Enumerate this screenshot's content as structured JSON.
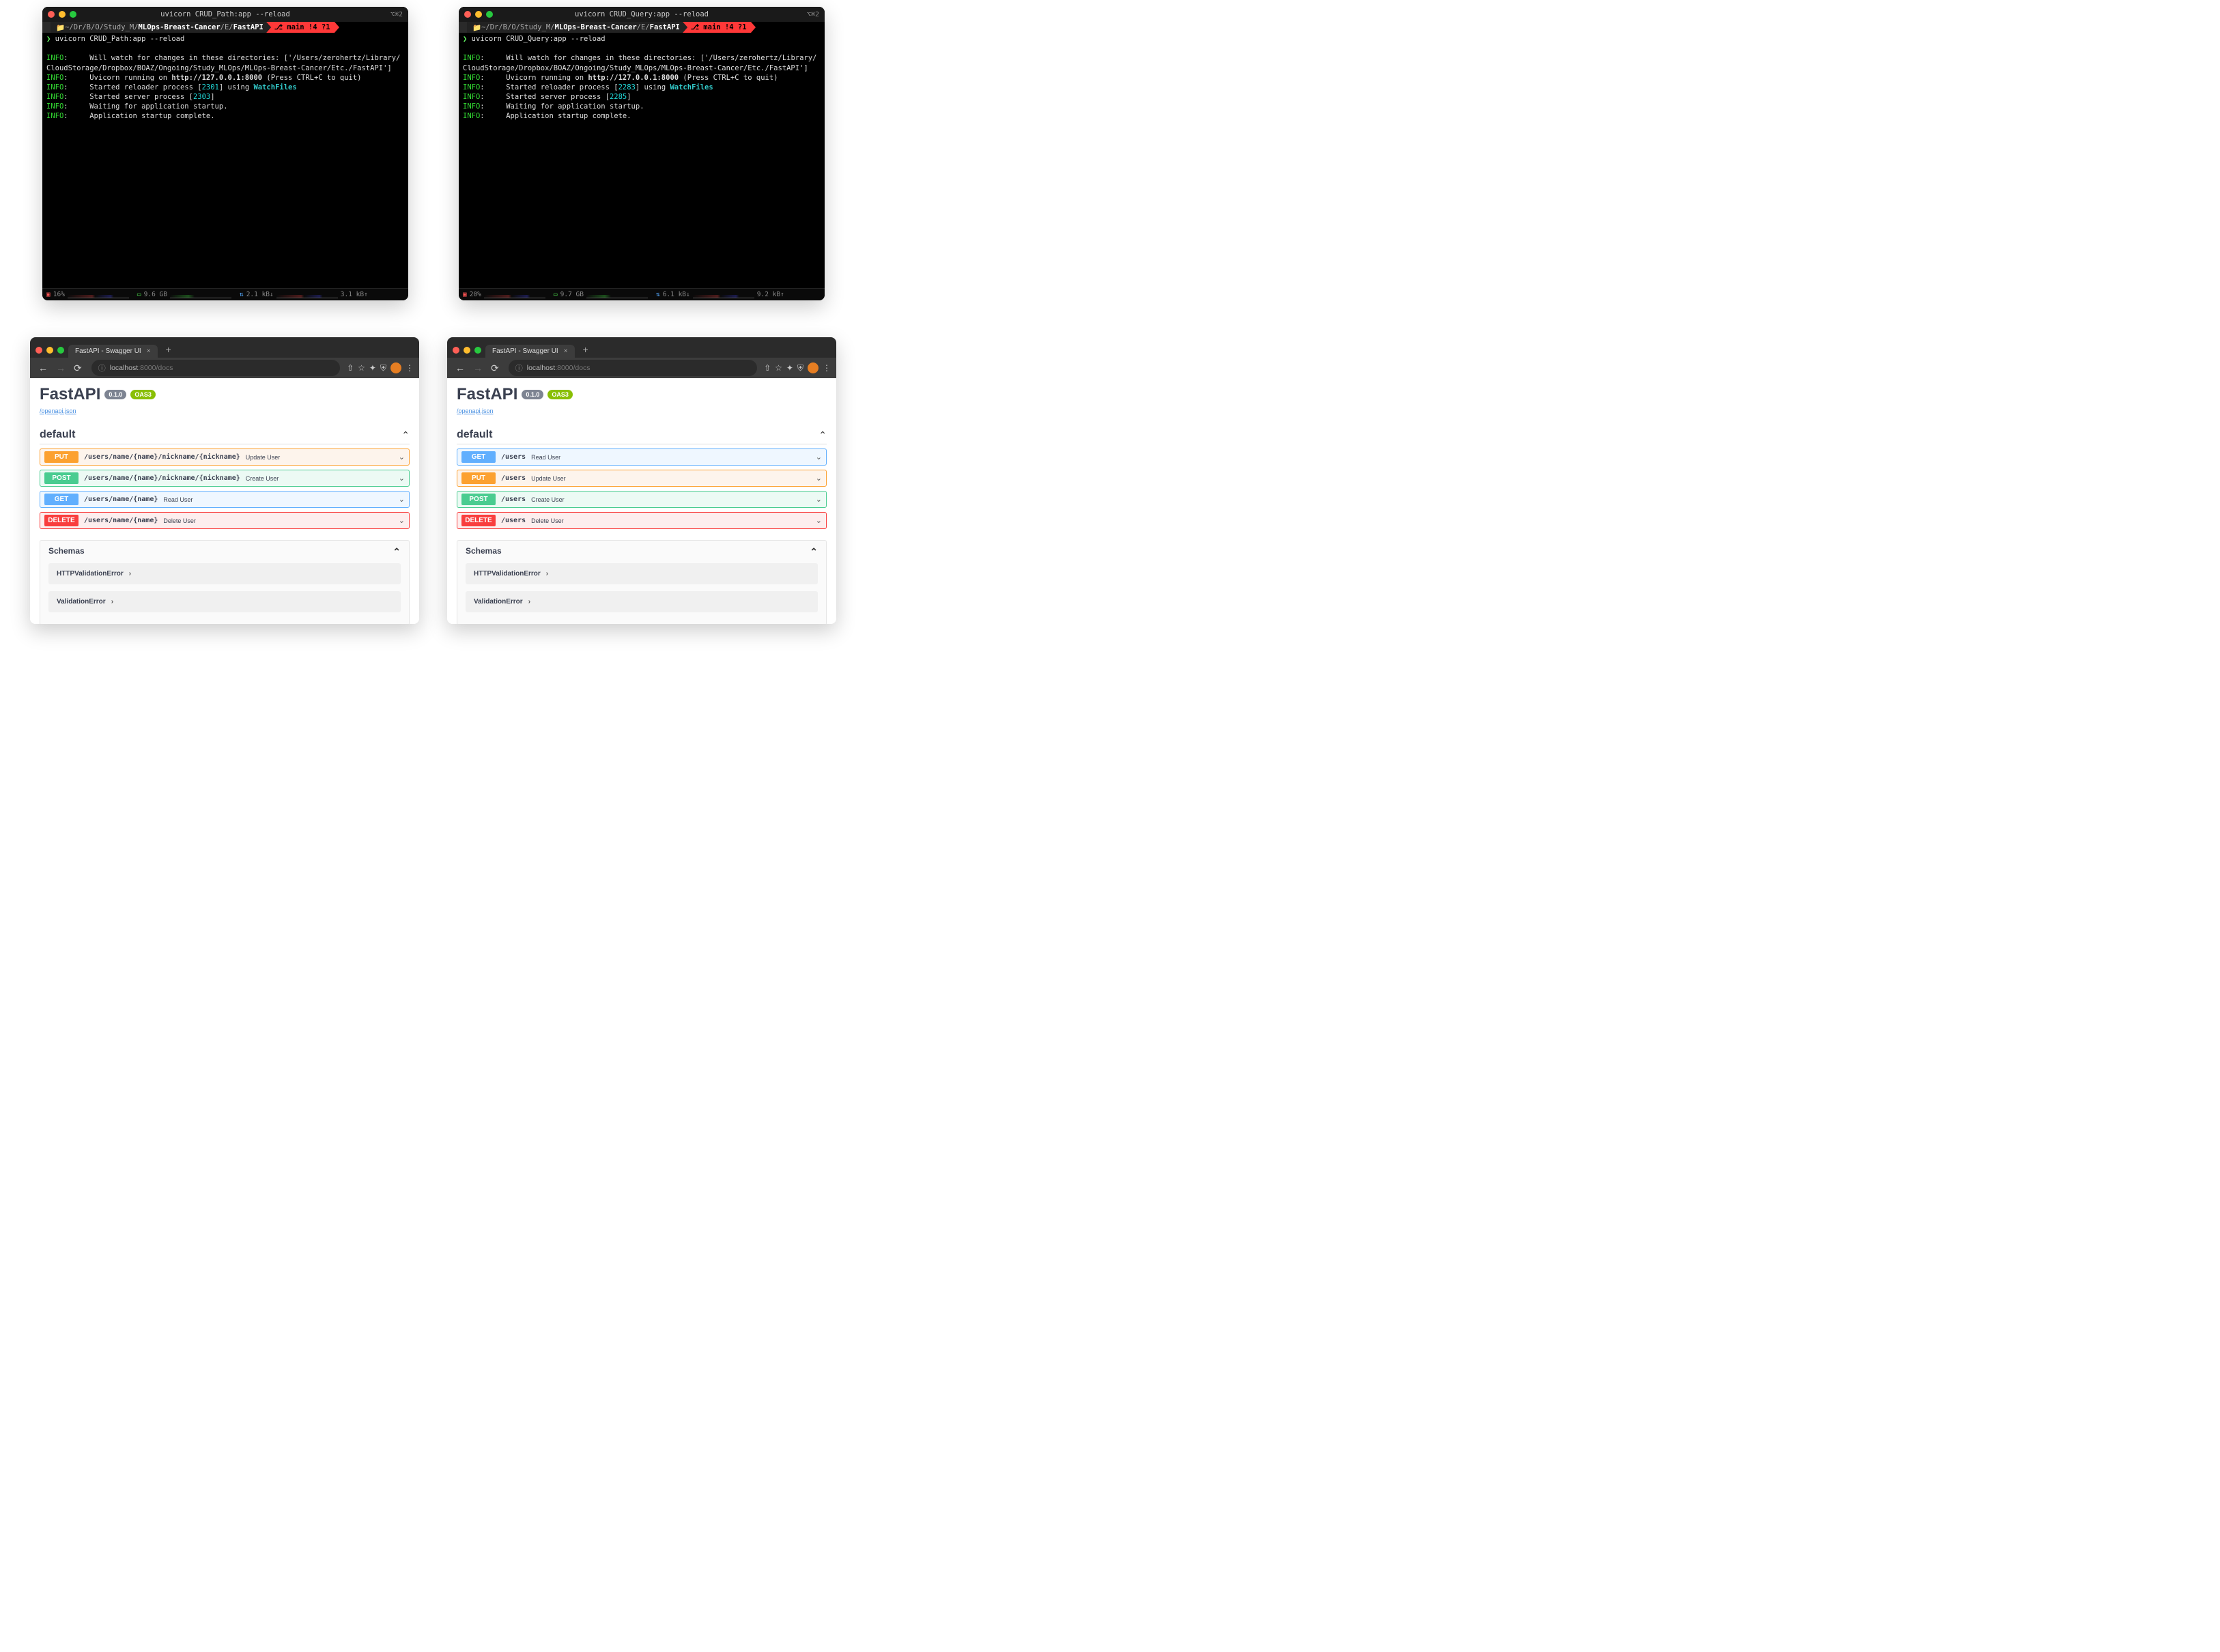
{
  "terminals": [
    {
      "title": "uvicorn CRUD_Path:app --reload",
      "right_indicator": "⌥⌘2",
      "path": {
        "prefix": "~/Dr/B/O/Study_M/",
        "bold1": "MLOps-Breast-Cancer",
        "mid": "/E/",
        "bold2": "FastAPI"
      },
      "git": "⎇ main !4 ?1",
      "command": "uvicorn CRUD_Path:app --reload",
      "lines": [
        "Will watch for changes in these directories: ['/Users/zerohertz/Library/CloudStorage/Dropbox/BOAZ/Ongoing/Study_MLOps/MLOps-Breast-Cancer/Etc./FastAPI']",
        "Uvicorn running on http://127.0.0.1:8000 (Press CTRL+C to quit)",
        "Started reloader process [2301] using WatchFiles",
        "Started server process [2303]",
        "Waiting for application startup.",
        "Application startup complete."
      ],
      "pid1": "2301",
      "pid2": "2303",
      "status": {
        "cpu": "16%",
        "mem": "9.6 GB",
        "net_down": "2.1 kB↓",
        "net_up": "3.1 kB↑"
      }
    },
    {
      "title": "uvicorn CRUD_Query:app --reload",
      "right_indicator": "⌥⌘2",
      "path": {
        "prefix": "~/Dr/B/O/Study_M/",
        "bold1": "MLOps-Breast-Cancer",
        "mid": "/E/",
        "bold2": "FastAPI"
      },
      "git": "⎇ main !4 ?1",
      "command": "uvicorn CRUD_Query:app --reload",
      "lines": [
        "Will watch for changes in these directories: ['/Users/zerohertz/Library/CloudStorage/Dropbox/BOAZ/Ongoing/Study_MLOps/MLOps-Breast-Cancer/Etc./FastAPI']",
        "Uvicorn running on http://127.0.0.1:8000 (Press CTRL+C to quit)",
        "Started reloader process [2283] using WatchFiles",
        "Started server process [2285]",
        "Waiting for application startup.",
        "Application startup complete."
      ],
      "pid1": "2283",
      "pid2": "2285",
      "status": {
        "cpu": "20%",
        "mem": "9.7 GB",
        "net_down": "6.1 kB↓",
        "net_up": "9.2 kB↑"
      }
    }
  ],
  "browsers": [
    {
      "tab_title": "FastAPI - Swagger UI",
      "url_host": "localhost",
      "url_path": ":8000/docs",
      "swagger": {
        "title": "FastAPI",
        "version": "0.1.0",
        "oas": "OAS3",
        "openapi_link": "/openapi.json",
        "section": "default",
        "ops": [
          {
            "method": "PUT",
            "cls": "put",
            "path": "/users/name/{name}/nickname/{nickname}",
            "summary": "Update User"
          },
          {
            "method": "POST",
            "cls": "post",
            "path": "/users/name/{name}/nickname/{nickname}",
            "summary": "Create User"
          },
          {
            "method": "GET",
            "cls": "get",
            "path": "/users/name/{name}",
            "summary": "Read User"
          },
          {
            "method": "DELETE",
            "cls": "delete",
            "path": "/users/name/{name}",
            "summary": "Delete User"
          }
        ],
        "schemas_label": "Schemas",
        "schemas": [
          "HTTPValidationError",
          "ValidationError"
        ]
      }
    },
    {
      "tab_title": "FastAPI - Swagger UI",
      "url_host": "localhost",
      "url_path": ":8000/docs",
      "swagger": {
        "title": "FastAPI",
        "version": "0.1.0",
        "oas": "OAS3",
        "openapi_link": "/openapi.json",
        "section": "default",
        "ops": [
          {
            "method": "GET",
            "cls": "get",
            "path": "/users",
            "summary": "Read User"
          },
          {
            "method": "PUT",
            "cls": "put",
            "path": "/users",
            "summary": "Update User"
          },
          {
            "method": "POST",
            "cls": "post",
            "path": "/users",
            "summary": "Create User"
          },
          {
            "method": "DELETE",
            "cls": "delete",
            "path": "/users",
            "summary": "Delete User"
          }
        ],
        "schemas_label": "Schemas",
        "schemas": [
          "HTTPValidationError",
          "ValidationError"
        ]
      }
    }
  ]
}
